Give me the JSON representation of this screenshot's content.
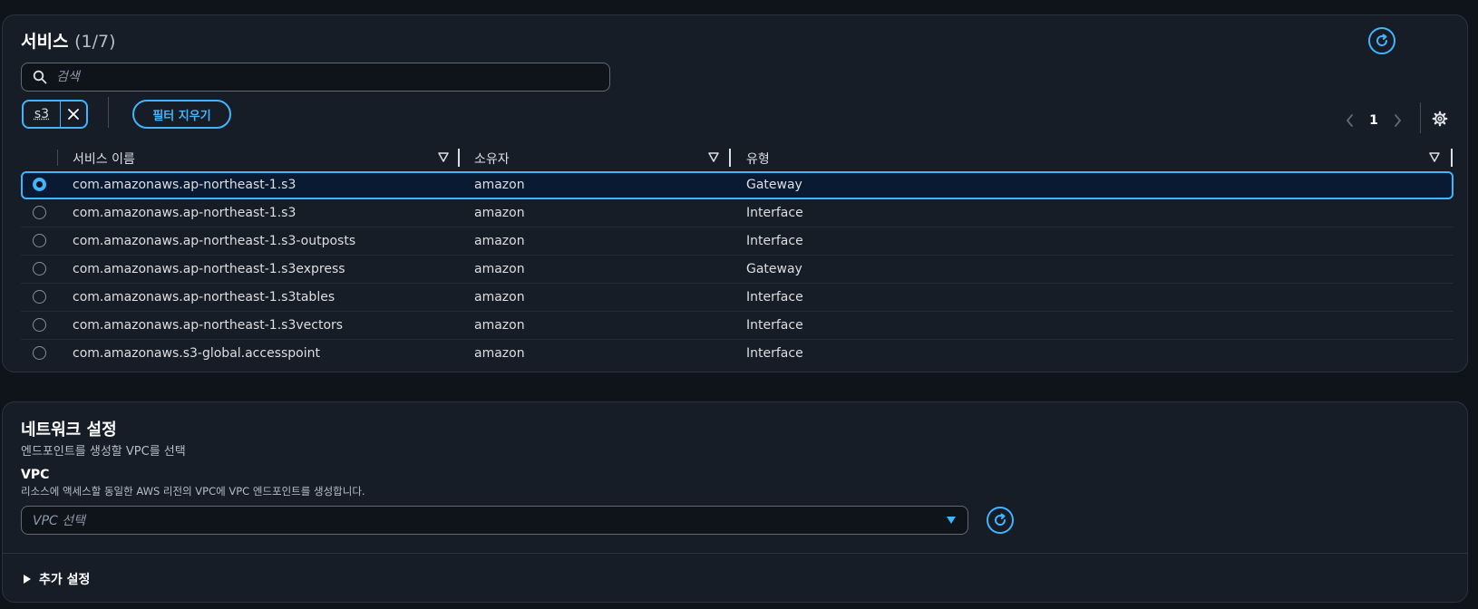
{
  "services": {
    "title": "서비스",
    "count": "(1/7)",
    "search_placeholder": "검색",
    "filter_token": "s3",
    "clear_filters_label": "필터 지우기",
    "pagination": {
      "current_page": "1"
    },
    "columns": [
      "서비스 이름",
      "소유자",
      "유형"
    ],
    "rows": [
      {
        "name": "com.amazonaws.ap-northeast-1.s3",
        "owner": "amazon",
        "type": "Gateway",
        "selected": true
      },
      {
        "name": "com.amazonaws.ap-northeast-1.s3",
        "owner": "amazon",
        "type": "Interface",
        "selected": false
      },
      {
        "name": "com.amazonaws.ap-northeast-1.s3-outposts",
        "owner": "amazon",
        "type": "Interface",
        "selected": false
      },
      {
        "name": "com.amazonaws.ap-northeast-1.s3express",
        "owner": "amazon",
        "type": "Gateway",
        "selected": false
      },
      {
        "name": "com.amazonaws.ap-northeast-1.s3tables",
        "owner": "amazon",
        "type": "Interface",
        "selected": false
      },
      {
        "name": "com.amazonaws.ap-northeast-1.s3vectors",
        "owner": "amazon",
        "type": "Interface",
        "selected": false
      },
      {
        "name": "com.amazonaws.s3-global.accesspoint",
        "owner": "amazon",
        "type": "Interface",
        "selected": false
      }
    ]
  },
  "network": {
    "title": "네트워크 설정",
    "subtitle": "엔드포인트를 생성할 VPC를 선택",
    "vpc_label": "VPC",
    "vpc_description": "리소스에 액세스할 동일한 AWS 리전의 VPC에 VPC 엔드포인트를 생성합니다.",
    "vpc_placeholder": "VPC 선택",
    "additional_settings_label": "추가 설정"
  },
  "icons": {
    "refresh": "refresh-icon",
    "search": "search-icon",
    "close": "close-icon",
    "settings": "gear-icon",
    "prev": "chevron-left-icon",
    "next": "chevron-right-icon",
    "sort": "sort-triangle-icon",
    "dropdown": "caret-down-icon",
    "expand": "caret-right-icon"
  },
  "colors": {
    "accent": "#42b4ff",
    "panel_bg": "#161d26",
    "page_bg": "#0f141a",
    "selected_row_bg": "#0a1a32"
  }
}
